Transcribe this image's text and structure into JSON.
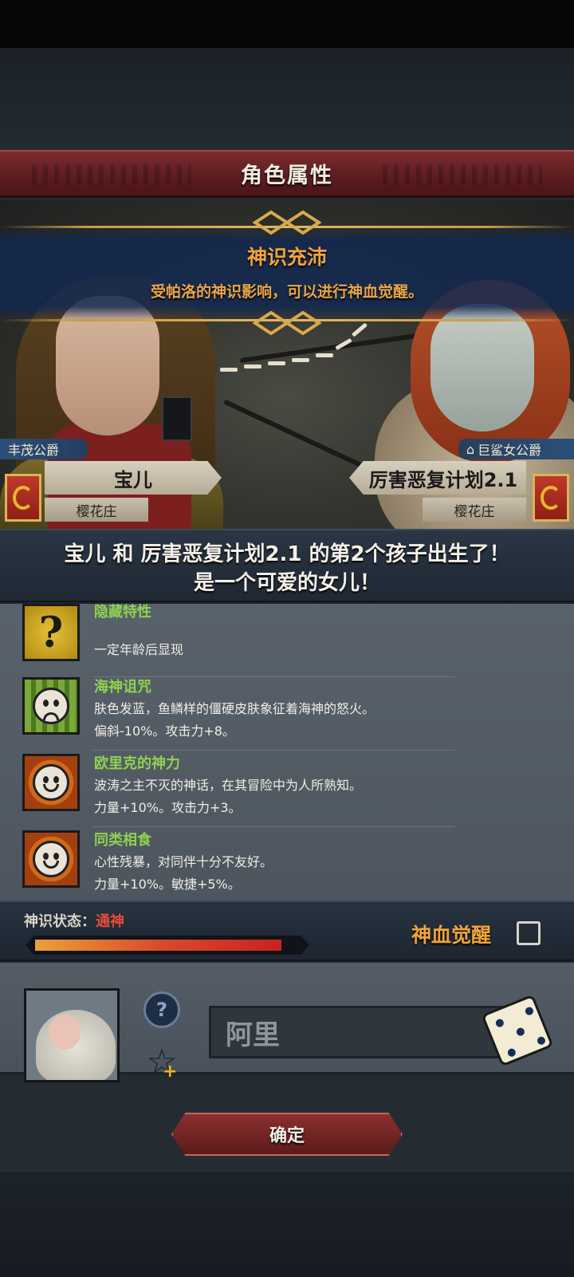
{
  "header": {
    "title": "角色属性"
  },
  "notice": {
    "title": "神识充沛",
    "text": "受帕洛的神识影响，可以进行神血觉醒。"
  },
  "father": {
    "title": "丰茂公爵",
    "name": "宝儿",
    "estate": "樱花庄"
  },
  "mother": {
    "title": "巨鲨女公爵",
    "name": "厉害恶复计划2.1",
    "estate": "樱花庄"
  },
  "birth": {
    "line1": "宝儿 和 厉害恶复计划2.1 的第2个孩子出生了！",
    "line2": "是一个可爱的女儿！"
  },
  "traits": [
    {
      "name": "隐藏特性",
      "desc1": "",
      "desc2": "一定年龄后显现",
      "icon": "question-icon"
    },
    {
      "name": "海神诅咒",
      "desc1": "肤色发蓝，鱼鳞样的僵硬皮肤象征着海神的怒火。",
      "desc2": "偏斜-10%。攻击力+8。",
      "icon": "sad-face-icon"
    },
    {
      "name": "欧里克的神力",
      "desc1": "波涛之主不灭的神话，在其冒险中为人所熟知。",
      "desc2": "力量+10%。攻击力+3。",
      "icon": "smile-face-icon"
    },
    {
      "name": "同类相食",
      "desc1": "心性残暴，对同伴十分不友好。",
      "desc2": "力量+10%。敏捷+5%。",
      "icon": "smile-face-icon"
    }
  ],
  "divine_state": {
    "label": "神识状态：",
    "value": "通神",
    "level_percent": 93
  },
  "awaken": {
    "label": "神血觉醒",
    "checked": false
  },
  "child": {
    "name_value": "阿里"
  },
  "confirm_label": "确定",
  "colors": {
    "accent_orange": "#f0a43a",
    "trait_green": "#8fd14f",
    "state_red": "#e84a3a"
  }
}
